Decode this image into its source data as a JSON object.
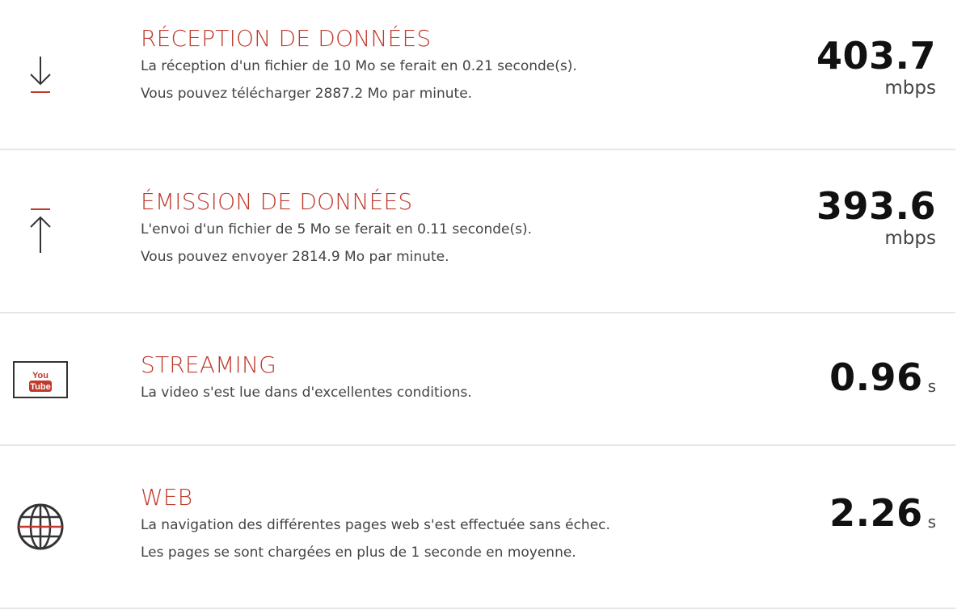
{
  "rows": [
    {
      "icon": "download-arrow-icon",
      "title": "RÉCEPTION DE DONNÉES",
      "lines": [
        "La réception d'un fichier de 10 Mo se ferait en 0.21 seconde(s).",
        "Vous pouvez télécharger 2887.2 Mo par minute."
      ],
      "value": "403.7",
      "unit": "mbps"
    },
    {
      "icon": "upload-arrow-icon",
      "title": "ÉMISSION DE DONNÉES",
      "lines": [
        "L'envoi d'un fichier de 5 Mo se ferait en 0.11 seconde(s).",
        "Vous pouvez envoyer 2814.9 Mo par minute."
      ],
      "value": "393.6",
      "unit": "mbps"
    },
    {
      "icon": "youtube-icon",
      "icon_text": [
        "You",
        "Tube"
      ],
      "title": "STREAMING",
      "lines": [
        "La video s'est lue dans d'excellentes conditions."
      ],
      "value": "0.96",
      "unit": "s"
    },
    {
      "icon": "globe-icon",
      "title": "WEB",
      "lines": [
        "La navigation des différentes pages web s'est effectuée sans échec.",
        "Les pages se sont chargées en plus de 1 seconde en moyenne."
      ],
      "value": "2.26",
      "unit": "s"
    }
  ],
  "colors": {
    "accent": "#c0392b",
    "text": "#444444",
    "value": "#111111",
    "divider": "#e6e6e6"
  }
}
